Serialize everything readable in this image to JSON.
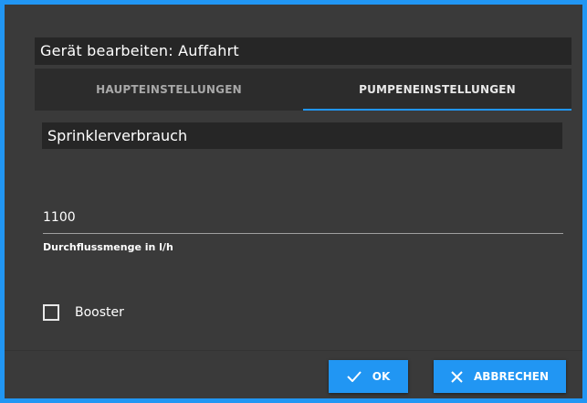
{
  "dialog": {
    "title": "Gerät bearbeiten: Auffahrt",
    "tabs": [
      {
        "label": "HAUPTEINSTELLUNGEN",
        "active": false
      },
      {
        "label": "PUMPENEINSTELLUNGEN",
        "active": true
      }
    ],
    "section_title": "Sprinklerverbrauch",
    "flow_field": {
      "value": "1100",
      "label": "Durchflussmenge in l/h"
    },
    "booster": {
      "label": "Booster",
      "checked": false
    },
    "buttons": {
      "ok_label": "OK",
      "cancel_label": "ABBRECHEN"
    }
  },
  "colors": {
    "accent": "#2196f3",
    "dialog_bg": "#3a3a3a",
    "field_bg": "#262626"
  },
  "icons": {
    "ok": "check-icon",
    "cancel": "close-icon"
  }
}
